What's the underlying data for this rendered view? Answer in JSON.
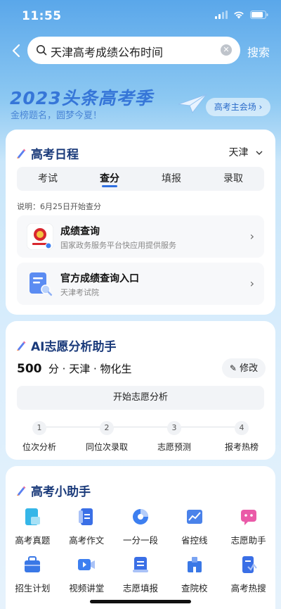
{
  "status": {
    "time": "11:55"
  },
  "search": {
    "query": "天津高考成绩公布时间",
    "button": "搜索"
  },
  "banner": {
    "title": "2023头条高考季",
    "subtitle": "金榜题名，圆梦今夏！",
    "button": "高考主会场 ›"
  },
  "schedule": {
    "title": "高考日程",
    "city": "天津",
    "tabs": [
      {
        "label": "考试"
      },
      {
        "label": "查分"
      },
      {
        "label": "填报"
      },
      {
        "label": "录取"
      }
    ],
    "active_tab": "查分",
    "note": "说明：6月25日开始查分",
    "entries": [
      {
        "title": "成绩查询",
        "subtitle": "国家政务服务平台快应用提供服务"
      },
      {
        "title": "官方成绩查询入口",
        "subtitle": "天津考试院"
      }
    ]
  },
  "ai": {
    "title": "AI志愿分析助手",
    "score": "500",
    "score_unit": "分 · 天津 · 物化生",
    "edit_button": "修改",
    "start_button": "开始志愿分析",
    "steps": [
      {
        "num": "1",
        "label": "位次分析"
      },
      {
        "num": "2",
        "label": "同位次录取"
      },
      {
        "num": "3",
        "label": "志愿预测"
      },
      {
        "num": "4",
        "label": "报考热榜"
      }
    ]
  },
  "helper": {
    "title": "高考小助手",
    "items": [
      {
        "label": "高考真题",
        "icon": "exam-paper-icon",
        "color": "#35b6e8"
      },
      {
        "label": "高考作文",
        "icon": "essay-icon",
        "color": "#3a6fe6"
      },
      {
        "label": "一分一段",
        "icon": "pie-chart-icon",
        "color": "#3d7ff0"
      },
      {
        "label": "省控线",
        "icon": "line-chart-icon",
        "color": "#4a82ea"
      },
      {
        "label": "志愿助手",
        "icon": "chat-assistant-icon",
        "color": "#ea5aa8"
      },
      {
        "label": "招生计划",
        "icon": "briefcase-icon",
        "color": "#3a78e6"
      },
      {
        "label": "视频讲堂",
        "icon": "video-icon",
        "color": "#3d7ff0"
      },
      {
        "label": "志愿填报",
        "icon": "form-icon",
        "color": "#3a6fe6"
      },
      {
        "label": "查院校",
        "icon": "building-icon",
        "color": "#3a78e6"
      },
      {
        "label": "高考热搜",
        "icon": "hot-search-icon",
        "color": "#3a6fe6"
      }
    ]
  },
  "colors": {
    "accent": "#2f6fe0",
    "title": "#1a3a7a"
  }
}
